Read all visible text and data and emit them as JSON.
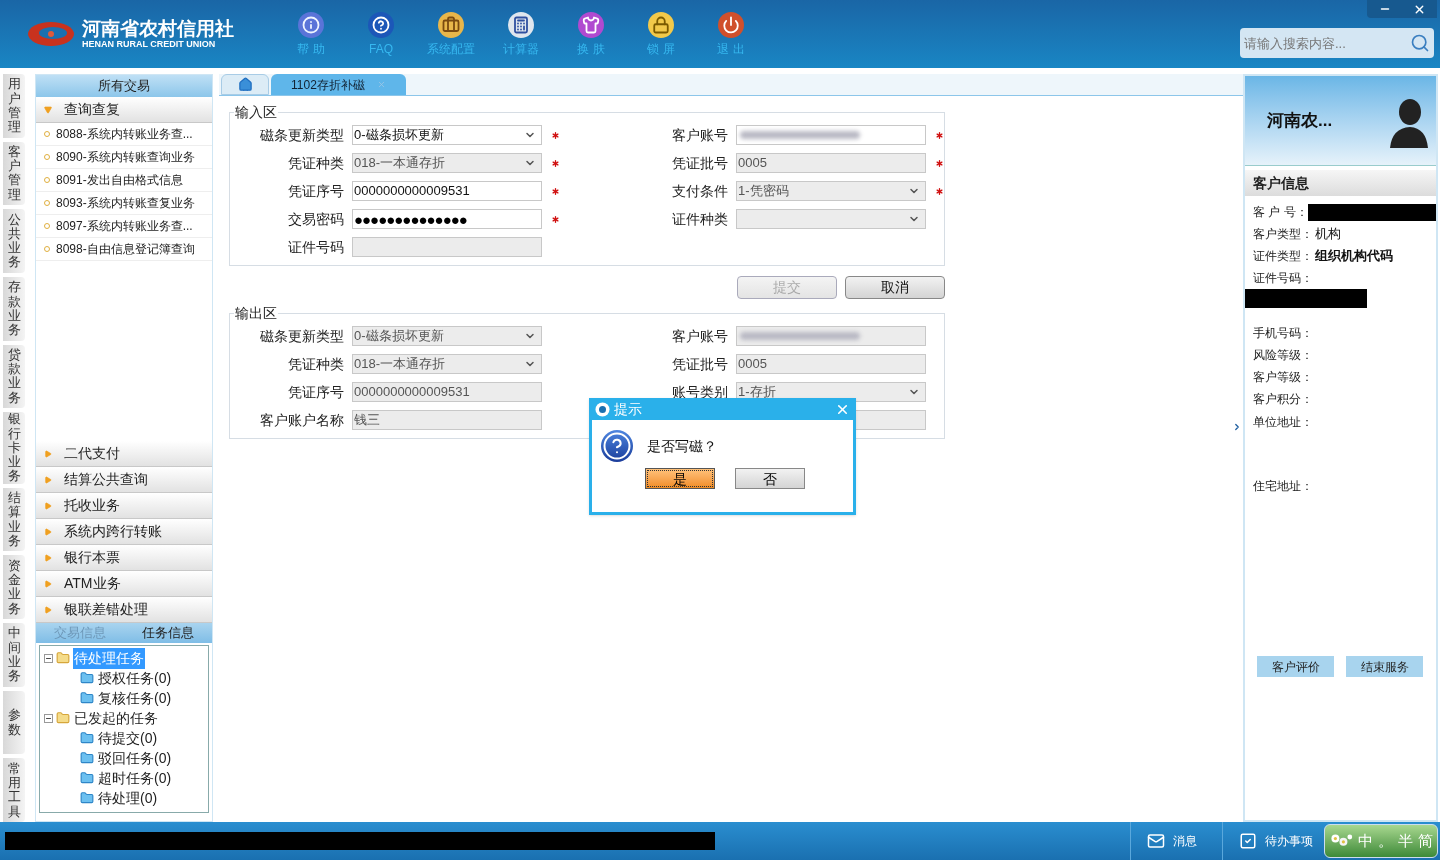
{
  "app": {
    "logo_title": "河南省农村信用社",
    "logo_subtitle": "HENAN RURAL CREDIT UNION"
  },
  "toolbar": [
    {
      "kind": "info",
      "label": "帮 助"
    },
    {
      "kind": "faq",
      "label": "FAQ"
    },
    {
      "kind": "config",
      "label": "系统配置"
    },
    {
      "kind": "calculator",
      "label": "计算器"
    },
    {
      "kind": "skin",
      "label": "换 肤"
    },
    {
      "kind": "lock",
      "label": "锁 屏"
    },
    {
      "kind": "exit",
      "label": "退 出"
    }
  ],
  "search": {
    "placeholder": "请输入搜索内容..."
  },
  "side_tabs": [
    "用户管理",
    "客户管理",
    "公共业务",
    "存款业务",
    "贷款业务",
    "银行卡业务",
    "结算业务",
    "资金业务",
    "中间业务",
    "参数",
    "常用工具"
  ],
  "sidebar": {
    "title": "所有交易",
    "groups": [
      {
        "label": "查询查复",
        "expanded": true,
        "items": [
          "8088-系统内转账业务查...",
          "8090-系统内转账查询业务",
          "8091-发出自由格式信息",
          "8093-系统内转账查复业务",
          "8097-系统内转账业务查...",
          "8098-自由信息登记簿查询"
        ]
      },
      {
        "label": "二代支付",
        "expanded": false
      },
      {
        "label": "结算公共查询",
        "expanded": false
      },
      {
        "label": "托收业务",
        "expanded": false
      },
      {
        "label": "系统内跨行转账",
        "expanded": false
      },
      {
        "label": "银行本票",
        "expanded": false
      },
      {
        "label": "ATM业务",
        "expanded": false
      },
      {
        "label": "银联差错处理",
        "expanded": false
      }
    ]
  },
  "task_panel": {
    "tabs": [
      {
        "label": "交易信息",
        "selected": false
      },
      {
        "label": "任务信息",
        "selected": true
      }
    ],
    "tree": [
      {
        "label": "待处理任务",
        "selected": true,
        "expanded": true,
        "children": [
          {
            "label": "授权任务(0)",
            "selected": false
          },
          {
            "label": "复核任务(0)",
            "selected": false
          }
        ]
      },
      {
        "label": "已发起的任务",
        "selected": false,
        "expanded": true,
        "children": [
          {
            "label": "待提交(0)",
            "selected": false
          },
          {
            "label": "驳回任务(0)",
            "selected": false
          },
          {
            "label": "超时任务(0)",
            "selected": false
          },
          {
            "label": "待处理(0)",
            "selected": false
          }
        ]
      }
    ]
  },
  "doc_tabs": [
    {
      "kind": "home",
      "selected": false
    },
    {
      "kind": "page",
      "label": "1102存折补磁",
      "selected": true
    }
  ],
  "input_section": {
    "title": "输入区",
    "rows": [
      [
        {
          "label": "磁条更新类型",
          "kind": "select",
          "value": "0-磁条损坏更新",
          "required": true,
          "disabled": false
        },
        {
          "label": "客户账号",
          "kind": "blurred",
          "required": true,
          "disabled": false
        }
      ],
      [
        {
          "label": "凭证种类",
          "kind": "select",
          "value": "018-一本通存折",
          "required": true,
          "disabled": true
        },
        {
          "label": "凭证批号",
          "kind": "text",
          "value": "0005",
          "required": true,
          "disabled": true
        }
      ],
      [
        {
          "label": "凭证序号",
          "kind": "text",
          "value": "0000000000009531",
          "required": true,
          "disabled": false
        },
        {
          "label": "支付条件",
          "kind": "select",
          "value": "1-凭密码",
          "required": true,
          "disabled": true
        }
      ],
      [
        {
          "label": "交易密码",
          "kind": "password",
          "value": "●●●●●●●●●●●●●●",
          "required": true,
          "disabled": false
        },
        {
          "label": "证件种类",
          "kind": "select",
          "required": false,
          "disabled": true
        }
      ],
      [
        {
          "label": "证件号码",
          "kind": "text",
          "required": false,
          "disabled": true
        }
      ]
    ]
  },
  "actions": [
    {
      "label": "提交",
      "disabled": true
    },
    {
      "label": "取消",
      "disabled": false
    }
  ],
  "output_section": {
    "title": "输出区",
    "rows": [
      [
        {
          "label": "磁条更新类型",
          "kind": "select",
          "value": "0-磁条损坏更新",
          "required": false,
          "disabled": true
        },
        {
          "label": "客户账号",
          "kind": "blurred",
          "required": false,
          "disabled": true
        }
      ],
      [
        {
          "label": "凭证种类",
          "kind": "select",
          "value": "018-一本通存折",
          "required": false,
          "disabled": true
        },
        {
          "label": "凭证批号",
          "kind": "text",
          "value": "0005",
          "required": false,
          "disabled": true
        }
      ],
      [
        {
          "label": "凭证序号",
          "kind": "text",
          "value": "0000000000009531",
          "required": false,
          "disabled": true
        },
        {
          "label": "账号类别",
          "kind": "select",
          "value": "1-存折",
          "required": false,
          "disabled": true
        }
      ],
      [
        {
          "label": "客户账户名称",
          "kind": "text",
          "value": "钱三",
          "required": false,
          "disabled": true
        },
        {
          "kind": "text",
          "required": false,
          "disabled": true
        }
      ]
    ]
  },
  "dialog": {
    "title": "提示",
    "message": "是否写磁？",
    "buttons": [
      {
        "label": "是",
        "selected": true
      },
      {
        "label": "否",
        "selected": false
      }
    ]
  },
  "customer": {
    "name": "河南农...",
    "section_title": "客户信息",
    "fields": [
      {
        "label": "客 户 号：",
        "kind": "redacted"
      },
      {
        "label": "客户类型：",
        "kind": "value",
        "value": "机构"
      },
      {
        "label": "证件类型：",
        "kind": "value",
        "value": "组织机构代码",
        "bold": true
      },
      {
        "label": "证件号码：",
        "kind": "redacted_below"
      },
      {
        "label": "手机号码：",
        "kind": "empty"
      },
      {
        "label": "风险等级：",
        "kind": "empty"
      },
      {
        "label": "客户等级：",
        "kind": "empty"
      },
      {
        "label": "客户积分：",
        "kind": "empty"
      },
      {
        "label": "单位地址：",
        "kind": "address"
      },
      {
        "label": "住宅地址：",
        "kind": "address"
      }
    ],
    "buttons": [
      "客户评价",
      "结束服务"
    ]
  },
  "status_bar": {
    "items": [
      {
        "kind": "message",
        "label": "消息"
      },
      {
        "kind": "todo",
        "label": "待办事项"
      }
    ],
    "ime": [
      "中",
      "。",
      "半",
      "简"
    ]
  }
}
